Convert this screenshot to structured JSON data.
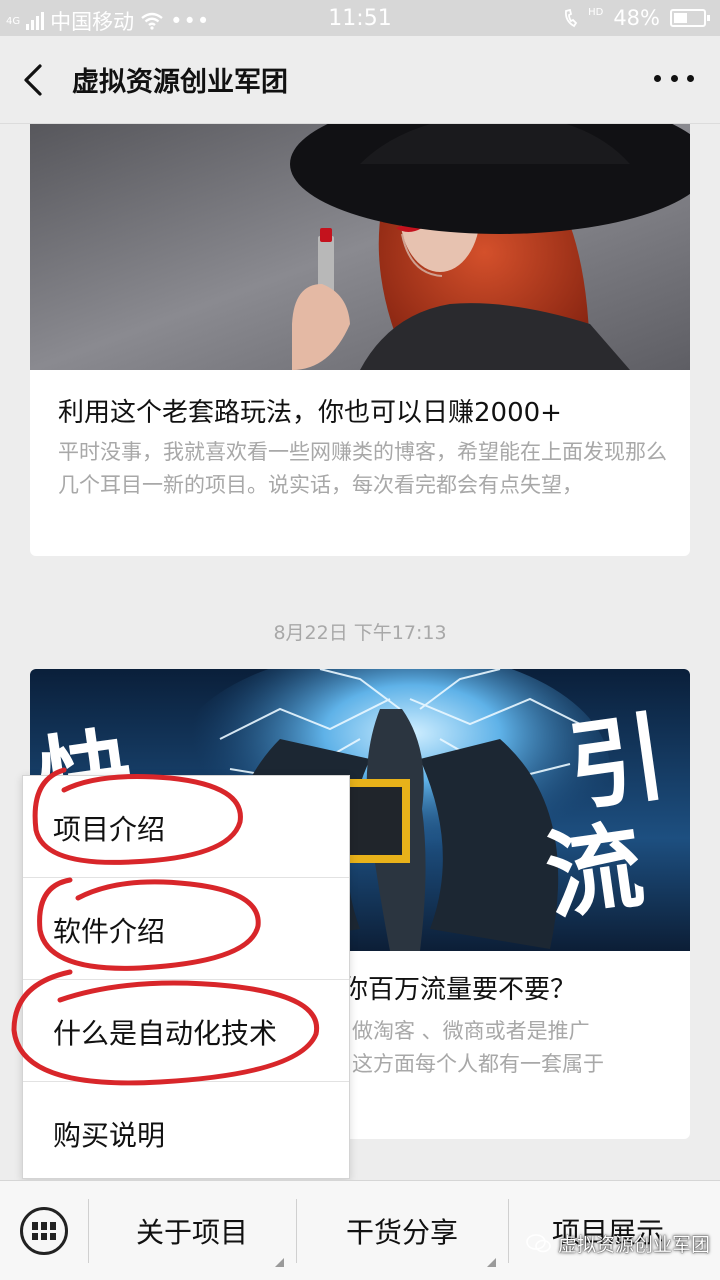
{
  "status_bar": {
    "network_tag": "4G",
    "carrier": "中国移动",
    "time": "11:51",
    "hd_tag": "HD",
    "battery_percent": "48%",
    "battery_level": 0.48
  },
  "header": {
    "title": "虚拟资源创业军团"
  },
  "articles": [
    {
      "title": "利用这个老套路玩法，你也可以日赚2000+",
      "description": "平时没事，我就喜欢看一些网赚类的博客，希望能在上面发现那么几个耳目一新的项目。说实话，每次看完都会有点失望，"
    },
    {
      "cover_text_left": "快",
      "cover_text_right_1": "引",
      "cover_text_right_2": "流",
      "title": "你百万流量要不要？",
      "description_line1": "做淘客 、微商或者是推广",
      "description_line2": "这方面每个人都有一套属于"
    }
  ],
  "timestamp": "8月22日 下午17:13",
  "popup_menu": {
    "items": [
      {
        "label": "项目介绍",
        "circled": true
      },
      {
        "label": "软件介绍",
        "circled": true
      },
      {
        "label": "什么是自动化技术",
        "circled": true
      },
      {
        "label": "购买说明",
        "circled": false
      }
    ]
  },
  "bottom_menu": {
    "items": [
      "关于项目",
      "干货分享",
      "项目展示"
    ]
  },
  "watermark": "虚拟资源创业军团",
  "colors": {
    "annotation_red": "#d8262a",
    "background": "#ededed",
    "muted_text": "#a8a8a8"
  }
}
